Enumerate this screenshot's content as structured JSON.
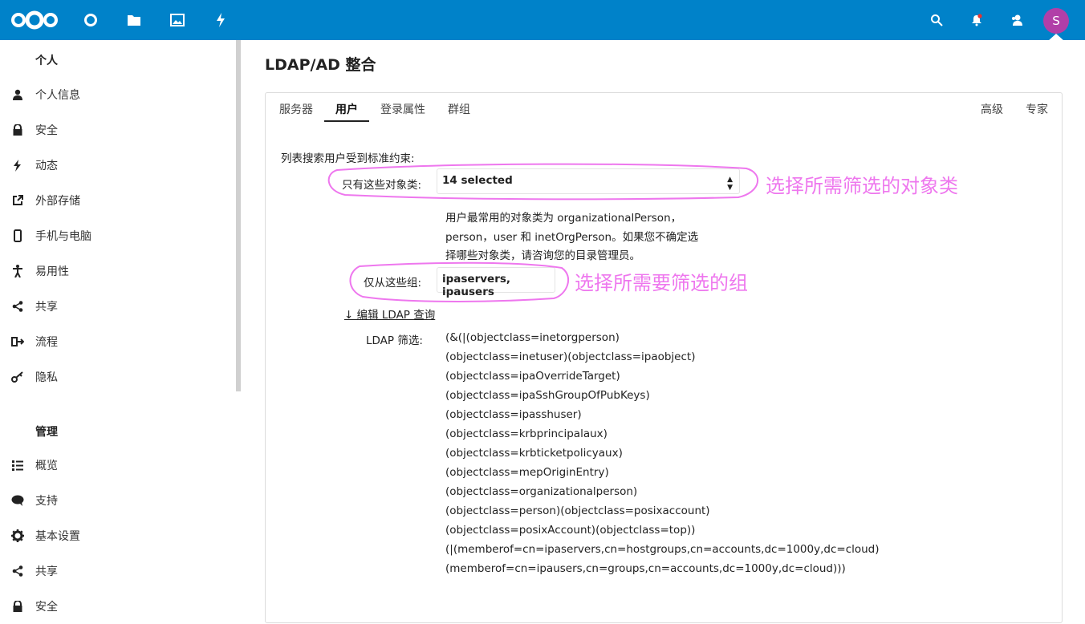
{
  "header": {
    "avatar_letter": "S",
    "accent": "#0082c9"
  },
  "sidebar": {
    "personal_heading": "个人",
    "personal_items": [
      {
        "label": "个人信息",
        "icon": "user-icon"
      },
      {
        "label": "安全",
        "icon": "lock-icon"
      },
      {
        "label": "动态",
        "icon": "lightning-icon"
      },
      {
        "label": "外部存储",
        "icon": "external-icon"
      },
      {
        "label": "手机与电脑",
        "icon": "phone-icon"
      },
      {
        "label": "易用性",
        "icon": "accessibility-icon"
      },
      {
        "label": "共享",
        "icon": "share-icon"
      },
      {
        "label": "流程",
        "icon": "flow-icon"
      },
      {
        "label": "隐私",
        "icon": "key-icon"
      }
    ],
    "admin_heading": "管理",
    "admin_items": [
      {
        "label": "概览",
        "icon": "list-icon"
      },
      {
        "label": "支持",
        "icon": "comment-icon"
      },
      {
        "label": "基本设置",
        "icon": "gear-icon"
      },
      {
        "label": "共享",
        "icon": "share-icon"
      },
      {
        "label": "安全",
        "icon": "lock-icon"
      }
    ]
  },
  "main": {
    "title": "LDAP/AD 整合",
    "tabs": [
      "服务器",
      "用户",
      "登录属性",
      "群组"
    ],
    "tabs_right": [
      "高级",
      "专家"
    ],
    "intro": "列表搜索用户受到标准约束:",
    "object_class_label": "只有这些对象类:",
    "object_class_value": "14 selected",
    "hint_lines": [
      "用户最常用的对象类为 organizationalPerson，",
      "person，user 和 inetOrgPerson。如果您不确定选",
      "择哪些对象类，请咨询您的目录管理员。"
    ],
    "groups_label": "仅从这些组:",
    "groups_value": "ipaservers, ipausers",
    "edit_link": "↓ 编辑 LDAP 查询",
    "filter_label": "LDAP 筛选:",
    "filter_lines": [
      "(&(|(objectclass=inetorgperson)",
      "(objectclass=inetuser)(objectclass=ipaobject)",
      "(objectclass=ipaOverrideTarget)",
      "(objectclass=ipaSshGroupOfPubKeys)",
      "(objectclass=ipasshuser)",
      "(objectclass=krbprincipalaux)",
      "(objectclass=krbticketpolicyaux)",
      "(objectclass=mepOriginEntry)",
      "(objectclass=organizationalperson)",
      "(objectclass=person)(objectclass=posixaccount)",
      "(objectclass=posixAccount)(objectclass=top))",
      "(|(memberof=cn=ipaservers,cn=hostgroups,cn=accounts,dc=1000y,dc=cloud)",
      "(memberof=cn=ipausers,cn=groups,cn=accounts,dc=1000y,dc=cloud)))"
    ]
  },
  "annotations": {
    "object_class_note": "选择所需筛选的对象类",
    "groups_note": "选择所需要筛选的组",
    "color": "#ee77ee"
  }
}
